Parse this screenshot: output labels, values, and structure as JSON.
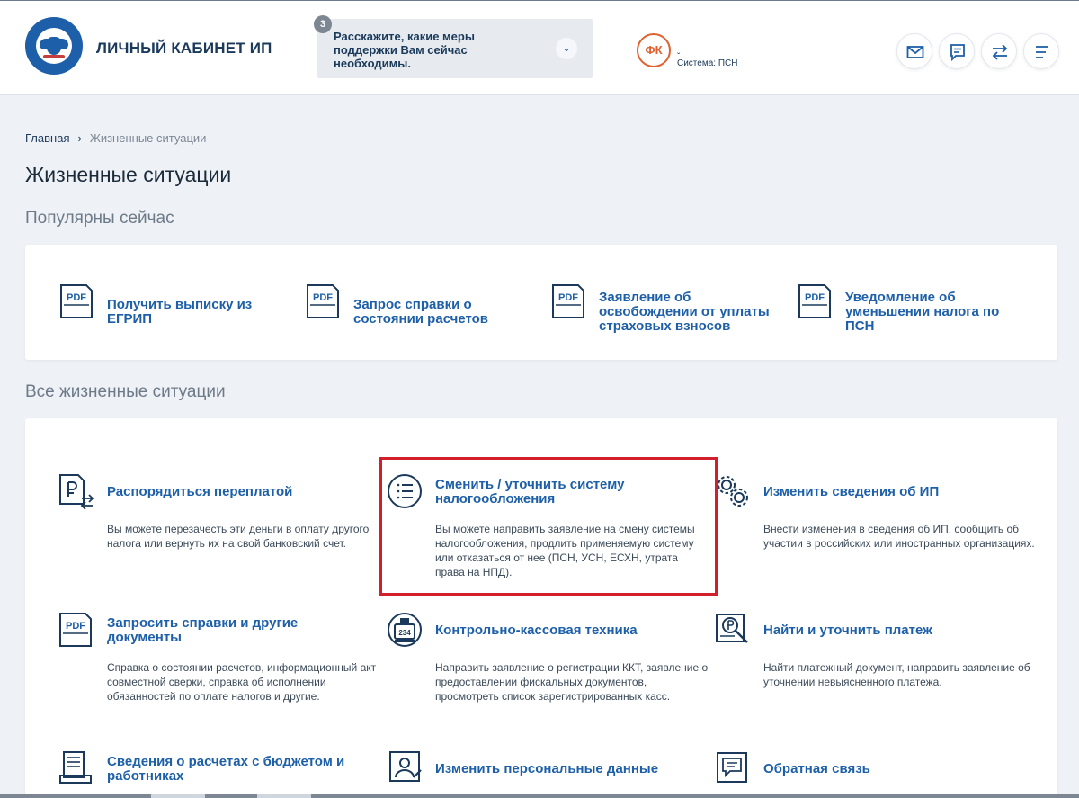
{
  "header": {
    "app_title": "ЛИЧНЫЙ КАБИНЕТ ИП",
    "support": {
      "count": "3",
      "text": "Расскажите, какие меры поддержки Вам сейчас необходимы."
    },
    "user": {
      "initials": "ФК",
      "name": "ˬ",
      "system": "Система: ПСН"
    },
    "buttons": [
      "mail-icon",
      "chat-icon",
      "swap-icon",
      "menu-icon"
    ]
  },
  "breadcrumb": {
    "home": "Главная",
    "separator": "›",
    "current": "Жизненные ситуации"
  },
  "page_title": "Жизненные ситуации",
  "popular": {
    "title": "Популярны сейчас",
    "items": [
      {
        "label": "Получить выписку из ЕГРИП",
        "icon": "pdf-icon"
      },
      {
        "label": "Запрос справки о состоянии расчетов",
        "icon": "pdf-icon"
      },
      {
        "label": "Заявление об освобождении от уплаты страховых взносов",
        "icon": "pdf-icon"
      },
      {
        "label": "Уведомление об уменьшении налога по ПСН",
        "icon": "pdf-icon"
      }
    ]
  },
  "all": {
    "title": "Все жизненные ситуации",
    "items": [
      {
        "title": "Распорядиться переплатой",
        "desc": "Вы можете перезачесть эти деньги в оплату другого налога или вернуть их на свой банковский счет.",
        "icon": "ruble-document-icon"
      },
      {
        "title": "Сменить / уточнить систему налогообложения",
        "desc": "Вы можете направить заявление на смену системы налогообложения, продлить применяемую систему или отказаться от нее (ПСН, УСН, ЕСХН, утрата права на НПД).",
        "icon": "list-circle-icon",
        "highlighted": true
      },
      {
        "title": "Изменить сведения об ИП",
        "desc": "Внести изменения в сведения об ИП, сообщить об участии в российских или иностранных организациях.",
        "icon": "gears-icon"
      },
      {
        "title": "Запросить справки и другие документы",
        "desc": "Справка о состоянии расчетов, информационный акт совместной сверки, справка об исполнении обязанностей по оплате налогов и другие.",
        "icon": "pdf-icon"
      },
      {
        "title": "Контрольно-кассовая техника",
        "desc": "Направить заявление о регистрации ККТ, заявление о предоставлении фискальных документов, просмотреть список зарегистрированных касс.",
        "icon": "cash-register-icon",
        "icon_text": "234"
      },
      {
        "title": "Найти и уточнить платеж",
        "desc": "Найти платежный документ, направить заявление об уточнении невыясненного платежа.",
        "icon": "ruble-search-icon"
      },
      {
        "title": "Сведения о расчетах с бюджетом и работниках",
        "desc": "",
        "icon": "report-icon"
      },
      {
        "title": "Изменить персональные данные",
        "desc": "",
        "icon": "person-card-icon"
      },
      {
        "title": "Обратная связь",
        "desc": "",
        "icon": "feedback-icon"
      }
    ]
  },
  "colors": {
    "accent": "#1d5fa8",
    "highlight_border": "#d11f2c",
    "avatar": "#e0602f"
  }
}
